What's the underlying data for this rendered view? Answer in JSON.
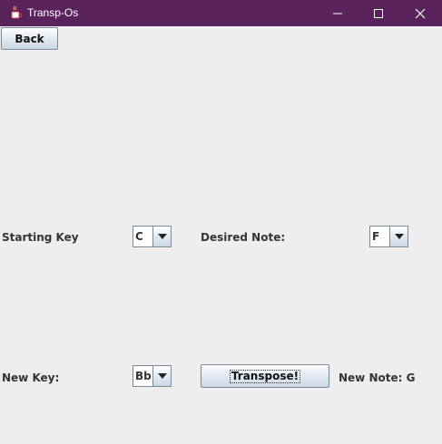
{
  "window": {
    "title": "Transp-Os"
  },
  "back_button": "Back",
  "starting_key": {
    "label": "Starting Key",
    "value": "C"
  },
  "desired_note": {
    "label": "Desired Note:",
    "value": "F"
  },
  "new_key": {
    "label": "New Key:",
    "value": "Bb"
  },
  "transpose_button": "Transpose!",
  "new_note": "New Note: G",
  "icons": {
    "app": "java-cup-icon",
    "minimize": "minimize-icon",
    "maximize": "maximize-icon",
    "close": "close-icon",
    "dropdown": "chevron-down-icon"
  },
  "colors": {
    "titlebar": "#58225a",
    "background": "#eeeeee"
  }
}
